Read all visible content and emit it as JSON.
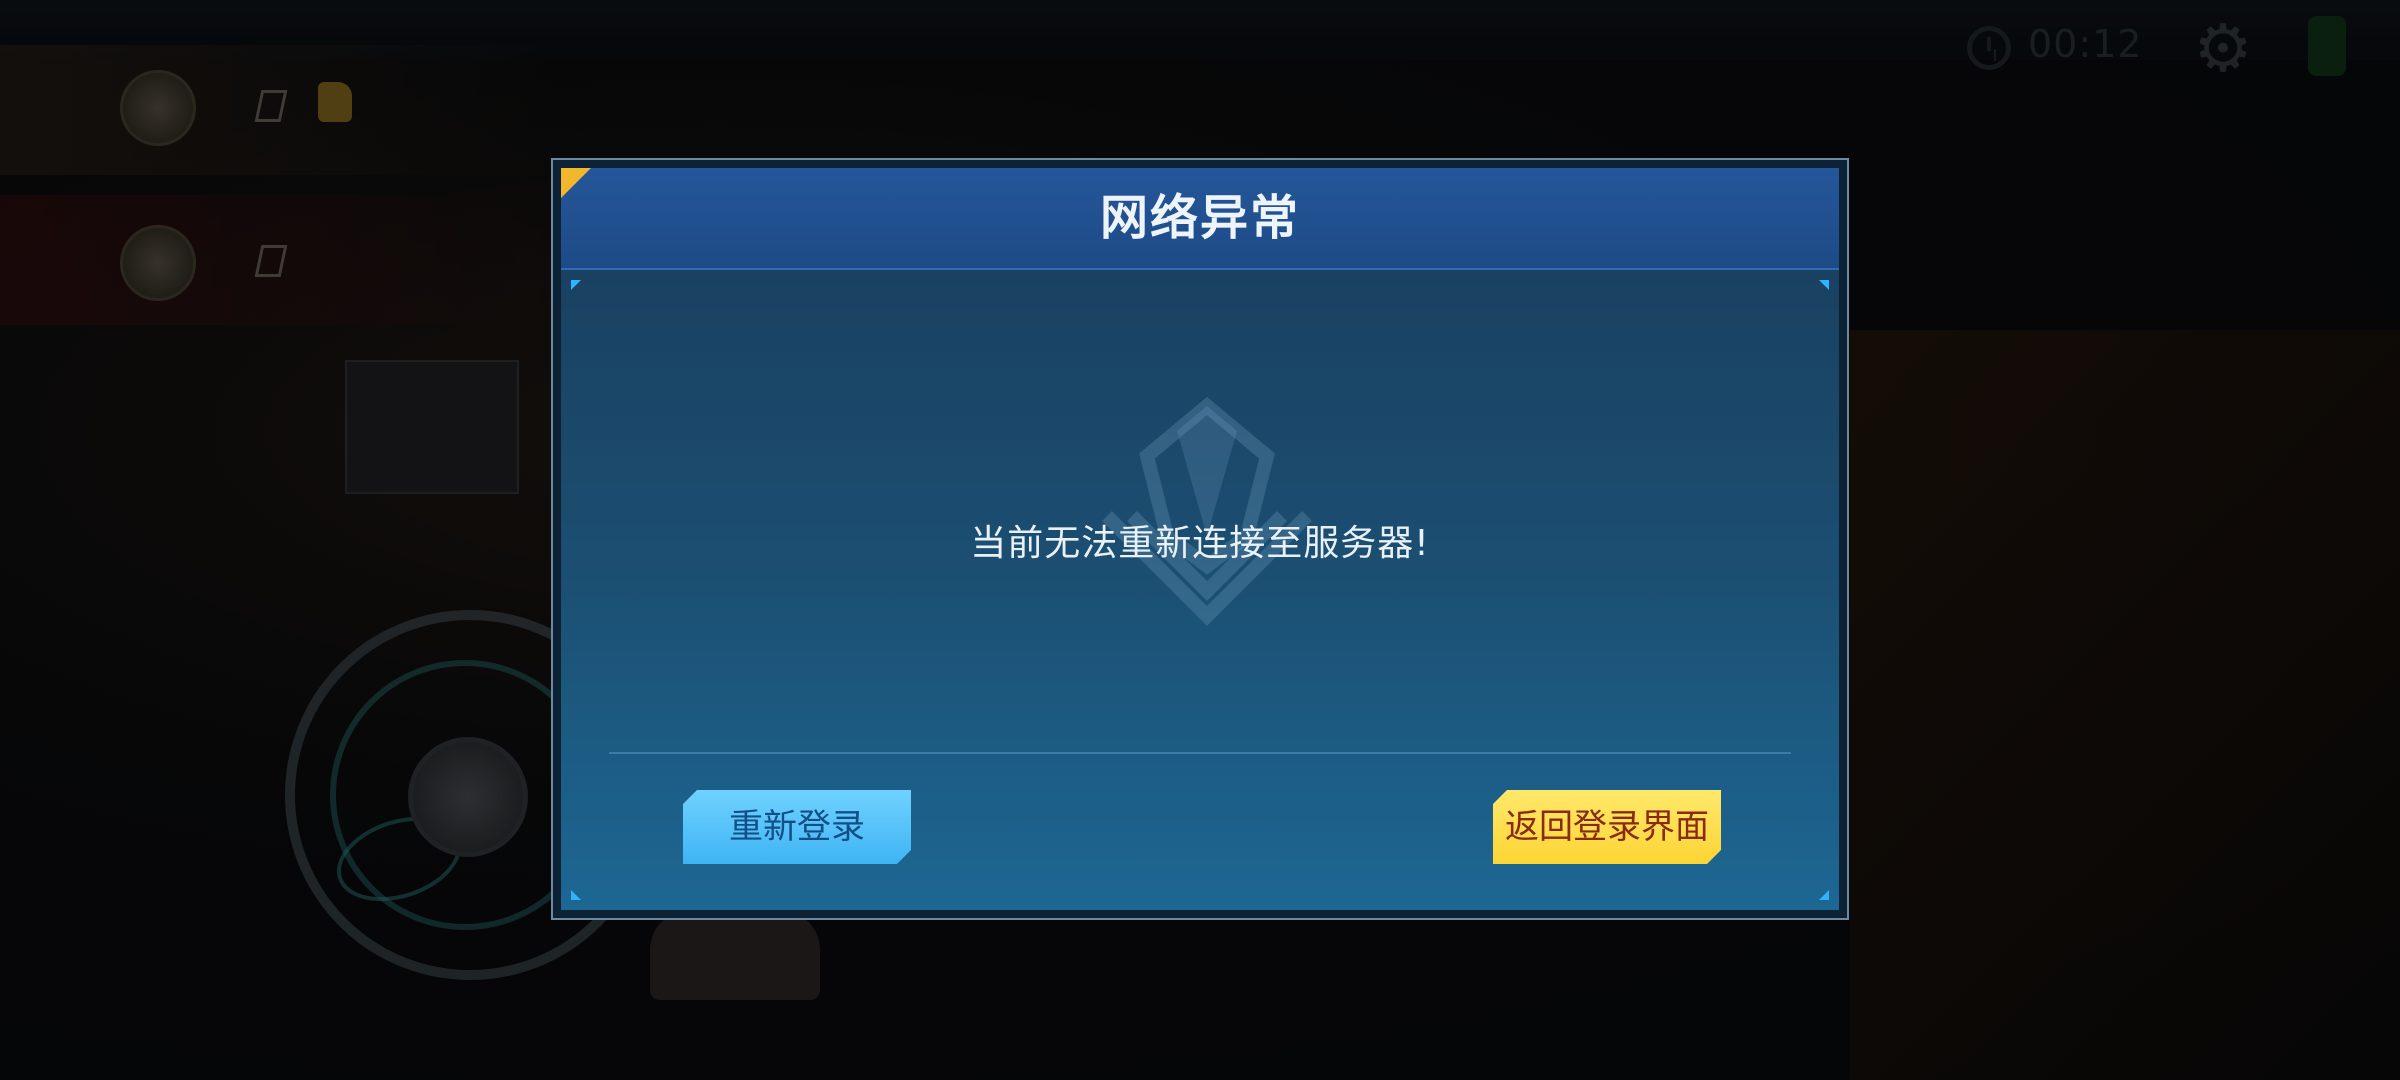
{
  "hud": {
    "timer": "00:12",
    "timer_icon": "clock-icon",
    "settings_icon": "gear-icon"
  },
  "dialog": {
    "title": "网络异常",
    "message": "当前无法重新连接至服务器!",
    "buttons": {
      "relogin_label": "重新登录",
      "return_label": "返回登录界面"
    },
    "colors": {
      "header": "#1e4b86",
      "body_top": "#1a3c5c",
      "body_bottom": "#1d6793",
      "relogin_bg": "#3fb4f4",
      "return_bg": "#fcd535",
      "corner_accent": "#f3b72f"
    }
  }
}
